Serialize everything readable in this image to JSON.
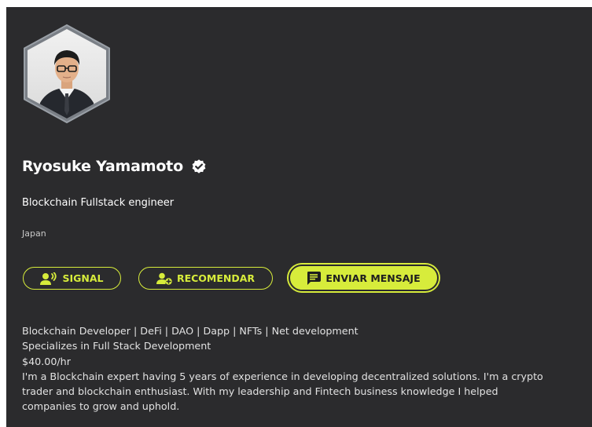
{
  "profile": {
    "name": "Ryosuke Yamamoto",
    "headline": "Blockchain Fullstack engineer",
    "location": "Japan"
  },
  "buttons": {
    "signal": "SIGNAL",
    "recomendar": "RECOMENDAR",
    "enviar_mensaje": "ENVIAR MENSAJE"
  },
  "about": {
    "lines": [
      "Blockchain Developer | DeFi | DAO | Dapp | NFTs | Net development",
      "Specializes in Full Stack Development",
      "$40.00/hr",
      "I'm a Blockchain expert having 5 years of experience in developing decentralized solutions. I'm a crypto",
      "trader and blockchain enthusiast. With my leadership and Fintech business knowledge I helped",
      "companies to grow and uphold."
    ]
  },
  "colors": {
    "background": "#2b2b2d",
    "accent": "#d7ec3b",
    "text": "#ffffff"
  },
  "icons": {
    "verified": "verified-badge-icon",
    "signal": "person-voice-icon",
    "recomendar": "person-add-icon",
    "mensaje": "message-icon"
  }
}
